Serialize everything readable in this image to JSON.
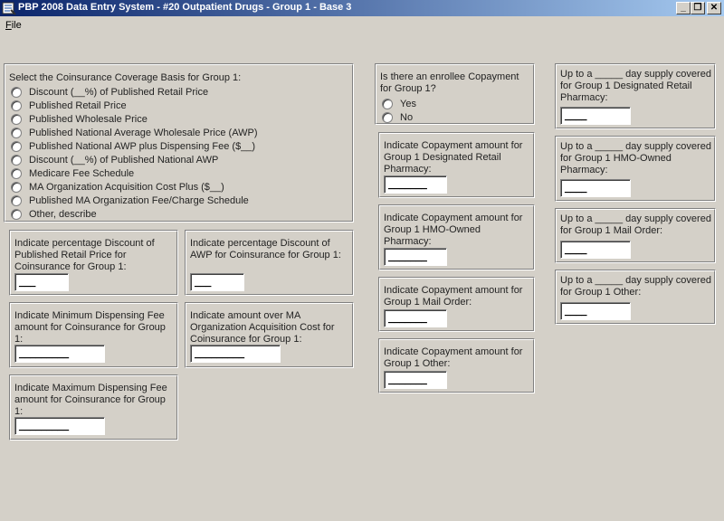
{
  "window": {
    "title": "PBP 2008 Data Entry System - #20 Outpatient Drugs - Group 1 - Base 3",
    "minimize": "_",
    "restore": "❐",
    "close": "✕"
  },
  "menu": {
    "file_first": "F",
    "file_rest": "ile"
  },
  "coinsurance_basis": {
    "prompt": "Select the Coinsurance Coverage Basis for Group 1:",
    "options": [
      "Discount (__%) of Published Retail Price",
      "Published Retail Price",
      "Published Wholesale Price",
      "Published National Average Wholesale Price (AWP)",
      "Published National AWP plus Dispensing Fee ($__)",
      "Discount (__%) of Published National AWP",
      "Medicare Fee Schedule",
      "MA Organization Acquisition Cost Plus ($__)",
      "Published MA Organization Fee/Charge Schedule",
      "Other, describe"
    ]
  },
  "fields": {
    "pct_retail": {
      "label": "Indicate percentage Discount of Published Retail Price for Coinsurance for Group 1:",
      "value": "___"
    },
    "pct_awp": {
      "label": "Indicate percentage Discount of AWP for Coinsurance for Group 1:",
      "value": "___"
    },
    "min_fee": {
      "label": "Indicate Minimum Dispensing Fee amount for Coinsurance for Group 1:",
      "value": "_________"
    },
    "over_cost": {
      "label": "Indicate amount over MA Organization Acquisition Cost for Coinsurance for Group 1:",
      "value": "_________"
    },
    "max_fee": {
      "label": "Indicate Maximum Dispensing Fee amount for Coinsurance for Group 1:",
      "value": "_________"
    }
  },
  "copay_question": {
    "prompt": "Is there an enrollee Copayment for Group 1?",
    "yes": "Yes",
    "no": "No"
  },
  "copay": {
    "retail": {
      "label": "Indicate Copayment amount for Group 1 Designated Retail Pharmacy:",
      "value": "_______"
    },
    "hmo": {
      "label": "Indicate Copayment amount for Group 1 HMO-Owned Pharmacy:",
      "value": "_______"
    },
    "mail": {
      "label": "Indicate Copayment amount for Group 1 Mail Order:",
      "value": "_______"
    },
    "other": {
      "label": "Indicate Copayment amount for Group 1 Other:",
      "value": "_______"
    }
  },
  "supply": {
    "retail": {
      "label": "Up to a _____ day supply covered for Group 1 Designated Retail Pharmacy:",
      "value": "____"
    },
    "hmo": {
      "label": "Up to a _____ day supply covered for Group 1 HMO-Owned Pharmacy:",
      "value": "____"
    },
    "mail": {
      "label": "Up to a _____ day supply covered for Group 1 Mail Order:",
      "value": "____"
    },
    "other": {
      "label": "Up to a _____ day supply covered for Group 1 Other:",
      "value": "____"
    }
  }
}
